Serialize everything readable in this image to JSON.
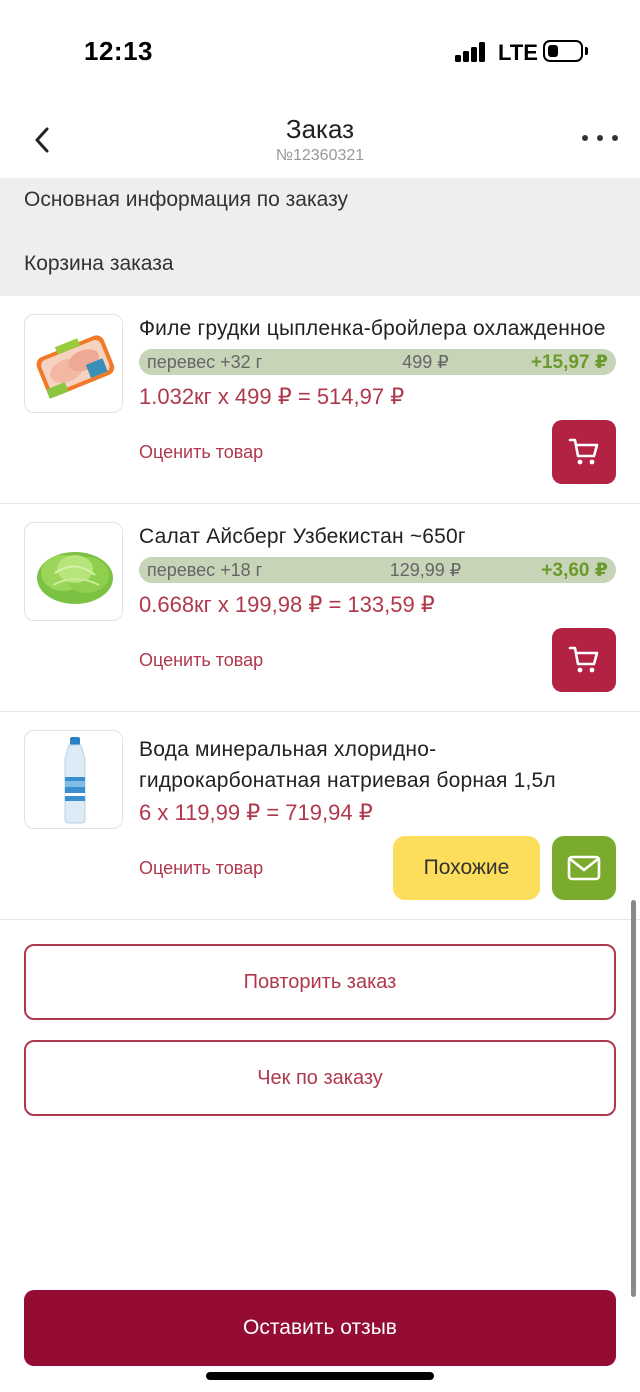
{
  "status": {
    "time": "12:13",
    "network": "LTE"
  },
  "nav": {
    "title": "Заказ",
    "order_number": "№12360321"
  },
  "info": {
    "main_info": "Основная информация по заказу",
    "cart": "Корзина заказа"
  },
  "products": [
    {
      "name": "Филе грудки цыпленка-бройлера охлажденное",
      "overweight": "перевес +32 г",
      "unit_price": "499 ₽",
      "extra": "+15,97 ₽",
      "calc": "1.032кг x 499 ₽ = 514,97 ₽",
      "rate": "Оценить товар",
      "image_icon": "chicken-fillet-package"
    },
    {
      "name": "Салат Айсберг Узбекистан ~650г",
      "overweight": "перевес +18 г",
      "unit_price": "129,99 ₽",
      "extra": "+3,60 ₽",
      "calc": "0.668кг x 199,98 ₽ = 133,59 ₽",
      "rate": "Оценить товар",
      "image_icon": "iceberg-lettuce"
    },
    {
      "name": "Вода минеральная хлоридно-гидрокарбонатная натриевая борная 1,5л",
      "calc": "6 x 119,99 ₽ = 719,94 ₽",
      "rate": "Оценить товар",
      "similar": "Похожие",
      "image_icon": "water-bottle"
    }
  ],
  "actions": {
    "repeat": "Повторить заказ",
    "receipt": "Чек по заказу",
    "review": "Оставить отзыв"
  },
  "colors": {
    "brand": "#950c33",
    "accent_text": "#b0384c",
    "cart_button": "#b32242",
    "similar_button": "#fddd5c",
    "mail_button": "#7aab2c",
    "weight_bar": "#c8d4b8",
    "extra_text": "#6a9a2a"
  }
}
